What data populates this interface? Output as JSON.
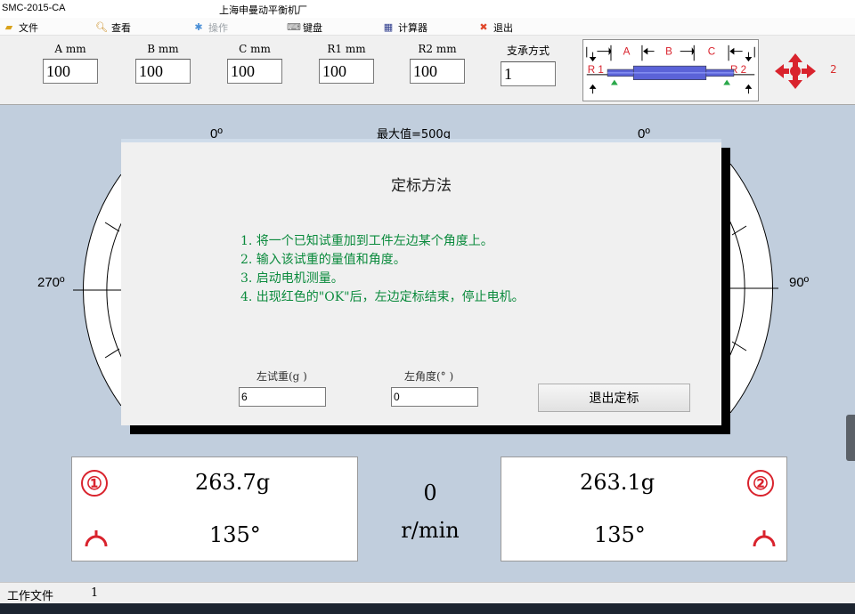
{
  "window": {
    "app_name": "SMC-2015-CA",
    "factory": "上海申曼动平衡机厂"
  },
  "menu": {
    "items": [
      {
        "label": "文件",
        "icon": "folder-icon"
      },
      {
        "label": "查看",
        "icon": "magnifier-icon"
      },
      {
        "label": "操作",
        "icon": "gear-icon",
        "disabled": true
      },
      {
        "label": "键盘",
        "icon": "keyboard-icon"
      },
      {
        "label": "计算器",
        "icon": "calculator-icon"
      },
      {
        "label": "退出",
        "icon": "exit-icon"
      }
    ]
  },
  "params": {
    "a": {
      "label": "A mm",
      "value": "100"
    },
    "b": {
      "label": "B mm",
      "value": "100"
    },
    "c": {
      "label": "C mm",
      "value": "100"
    },
    "r1": {
      "label": "R1 mm",
      "value": "100"
    },
    "r2": {
      "label": "R2 mm",
      "value": "100"
    },
    "support": {
      "label": "支承方式",
      "value": "1"
    }
  },
  "diagram": {
    "a": "A",
    "b": "B",
    "c": "C",
    "r1": "R 1",
    "r2": "R 2"
  },
  "support_count": "2",
  "dial": {
    "left_top": "0º",
    "left_side": "270º",
    "right_top": "0º",
    "right_side": "90º",
    "max_value": "最大值=500g"
  },
  "dialog": {
    "title": "定标方法",
    "steps": [
      "1. 将一个已知试重加到工件左边某个角度上。",
      "2. 输入该试重的量值和角度。",
      "3. 启动电机测量。",
      "4. 出现红色的\"OK\"后，左边定标结束，停止电机。"
    ],
    "weight_label": "左试重(g )",
    "weight_value": "6",
    "angle_label": "左角度(° )",
    "angle_value": "0",
    "exit_label": "退出定标"
  },
  "results": {
    "left": {
      "marker": "①",
      "weight": "263.7g",
      "angle": "135°"
    },
    "right": {
      "marker": "②",
      "weight": "263.1g",
      "angle": "135°"
    },
    "speed_value": "0",
    "speed_unit": "r/min"
  },
  "status": {
    "label": "工作文件",
    "value": "1"
  },
  "colors": {
    "accent_red": "#d9232d",
    "instruction_green": "#0a8a3c",
    "bar_blue": "#5b63d8"
  }
}
